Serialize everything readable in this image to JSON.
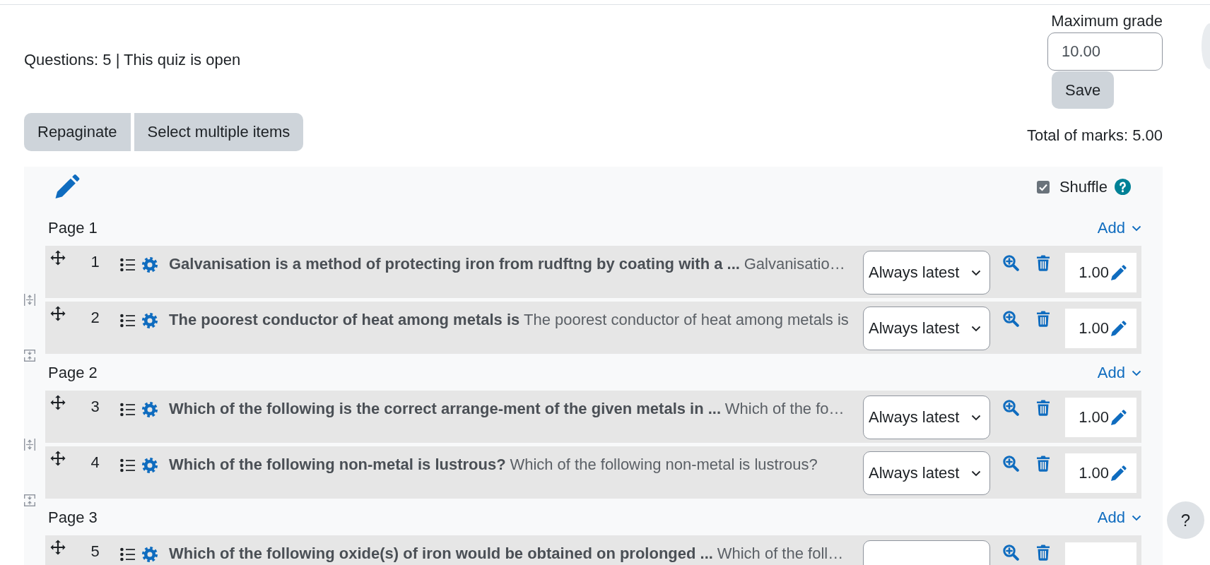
{
  "status": "Questions: 5 | This quiz is open",
  "maximum_grade": {
    "label": "Maximum grade",
    "value": "10.00",
    "save": "Save"
  },
  "toolbar": [
    "Repaginate",
    "Select multiple items"
  ],
  "total_marks": "Total of marks: 5.00",
  "section": {
    "shuffle": {
      "label": "Shuffle",
      "checked": true
    },
    "pages": [
      {
        "title": "Page 1",
        "add": "Add",
        "questions": [
          {
            "number": "1",
            "name": "Galvanisation is a method of protecting iron from rudftng by coating with a ...",
            "text": "Galvanisatio…",
            "version": "Always latest",
            "mark": "1.00"
          },
          {
            "number": "2",
            "name": "The poorest conductor of heat among metals is",
            "text": "The poorest conductor of heat among metals is",
            "version": "Always latest",
            "mark": "1.00"
          }
        ]
      },
      {
        "title": "Page 2",
        "add": "Add",
        "questions": [
          {
            "number": "3",
            "name": "Which of the following is the correct arrange-ment of the given metals in ...",
            "text": "Which of the fo…",
            "version": "Always latest",
            "mark": "1.00"
          },
          {
            "number": "4",
            "name": "Which of the following non-metal is lustrous?",
            "text": "Which of the following non-metal is lustrous?",
            "version": "Always latest",
            "mark": "1.00"
          }
        ]
      },
      {
        "title": "Page 3",
        "add": "Add",
        "questions": [
          {
            "number": "5",
            "name": "Which of the following oxide(s) of iron would be obtained on prolonged ...",
            "text": "Which of the foll…"
          }
        ]
      }
    ]
  },
  "help_button": "?"
}
